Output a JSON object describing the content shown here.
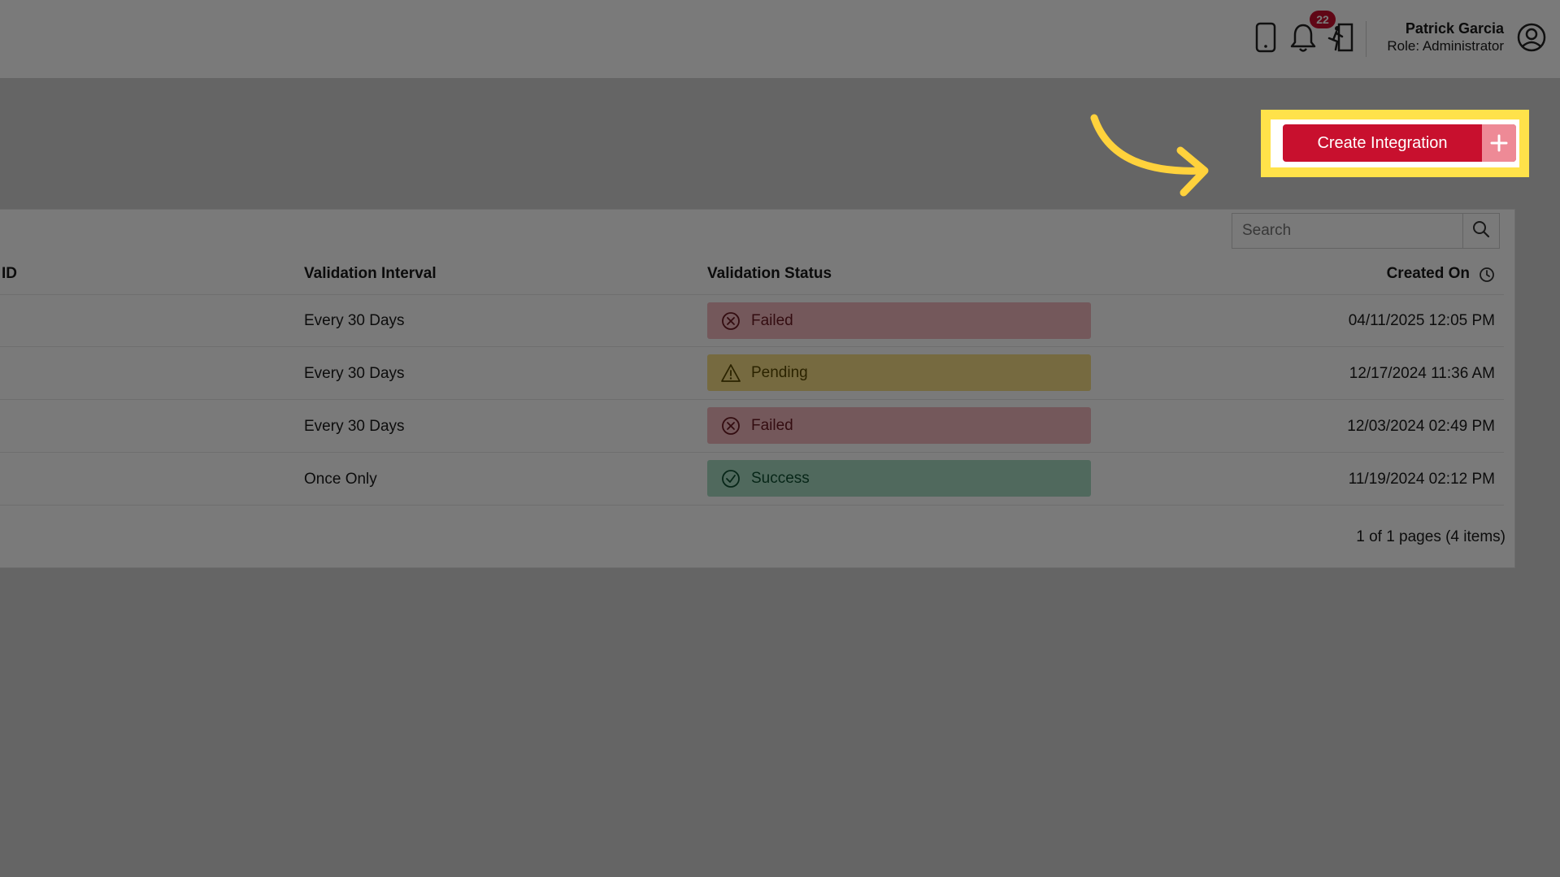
{
  "header": {
    "notification_count": "22",
    "user_name": "Patrick Garcia",
    "user_role": "Role: Administrator"
  },
  "actions": {
    "create_label": "Create Integration",
    "create_plus": "+"
  },
  "search": {
    "placeholder": "Search"
  },
  "table": {
    "columns": {
      "id": "ID",
      "interval": "Validation Interval",
      "status": "Validation Status",
      "created": "Created On"
    },
    "rows": [
      {
        "interval": "Every 30 Days",
        "status": "Failed",
        "created": "04/11/2025 12:05 PM"
      },
      {
        "interval": "Every 30 Days",
        "status": "Pending",
        "created": "12/17/2024 11:36 AM"
      },
      {
        "interval": "Every 30 Days",
        "status": "Failed",
        "created": "12/03/2024 02:49 PM"
      },
      {
        "interval": "Once Only",
        "status": "Success",
        "created": "11/19/2024 02:12 PM"
      }
    ],
    "pager": "1 of 1 pages (4 items)"
  },
  "colors": {
    "brand_red": "#c8102e",
    "highlight_yellow": "#ffe24a",
    "failed_bg": "#f2b8bf",
    "pending_bg": "#f6dd86",
    "success_bg": "#a7dcc3"
  },
  "icons": [
    "mobile-icon",
    "bell-icon",
    "exit-icon",
    "user-circle-icon",
    "plus-icon",
    "search-icon",
    "clock-icon",
    "x-circle-icon",
    "warning-icon",
    "check-circle-icon",
    "arrow-icon"
  ]
}
